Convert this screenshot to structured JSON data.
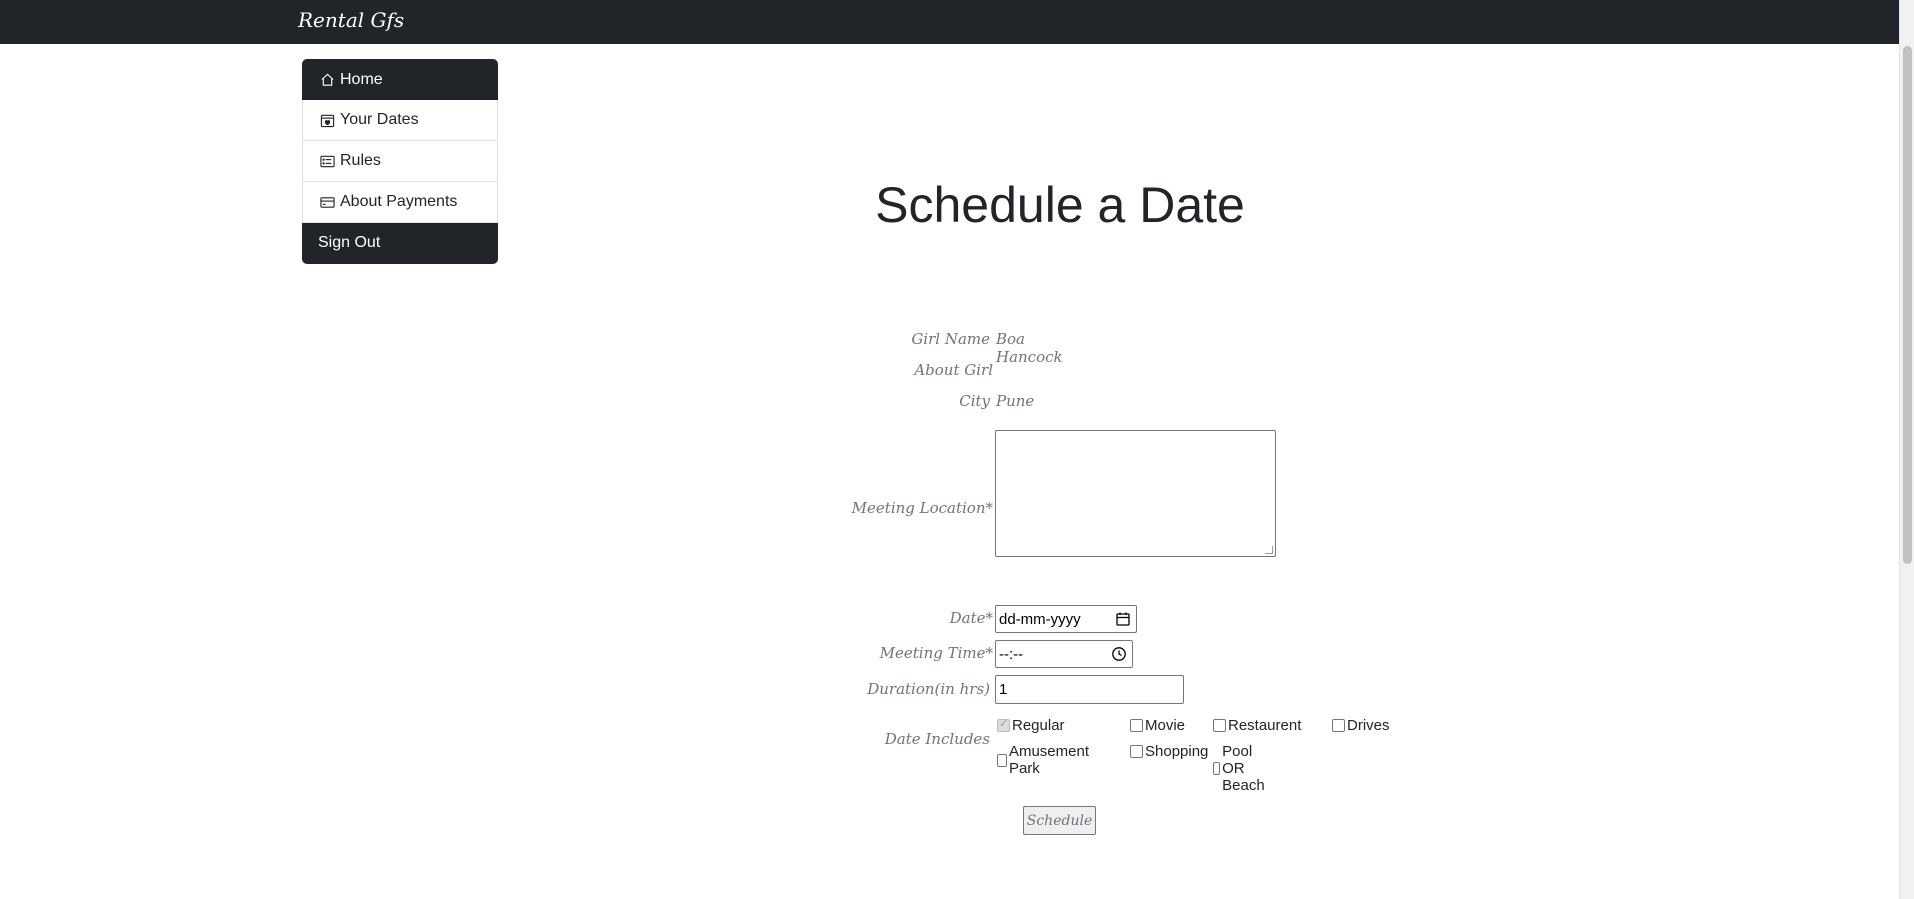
{
  "app": {
    "brand": "Rental Gfs"
  },
  "sidebar": {
    "items": [
      {
        "label": "Home",
        "icon": "house-icon"
      },
      {
        "label": "Your Dates",
        "icon": "calendar-heart-icon"
      },
      {
        "label": "Rules",
        "icon": "card-list-icon"
      },
      {
        "label": "About Payments",
        "icon": "credit-card-icon"
      },
      {
        "label": "Sign Out"
      }
    ]
  },
  "main": {
    "title": "Schedule a Date",
    "girl_name_label": "Girl Name",
    "girl_name_value": "Boa Hancock",
    "about_label": "About Girl",
    "city_label": "City",
    "city_value": "Pune",
    "meeting_location_label": "Meeting Location*",
    "meeting_location_value": "",
    "date_label": "Date*",
    "date_placeholder": "dd-mm-yyyy",
    "time_label": "Meeting Time*",
    "time_placeholder": "--:--",
    "duration_label": "Duration(in hrs)",
    "duration_value": "1",
    "includes_label": "Date Includes",
    "includes": [
      {
        "label": "Regular",
        "checked": true
      },
      {
        "label": "Movie",
        "checked": false
      },
      {
        "label": "Restaurent",
        "checked": false
      },
      {
        "label": "Drives",
        "checked": false
      },
      {
        "label": "Amusement Park",
        "checked": false
      },
      {
        "label": "Shopping",
        "checked": false
      },
      {
        "label": "Pool OR Beach",
        "checked": false
      }
    ],
    "submit_label": "Schedule"
  },
  "colors": {
    "navbar": "#212529",
    "label_muted": "#6c757d"
  }
}
